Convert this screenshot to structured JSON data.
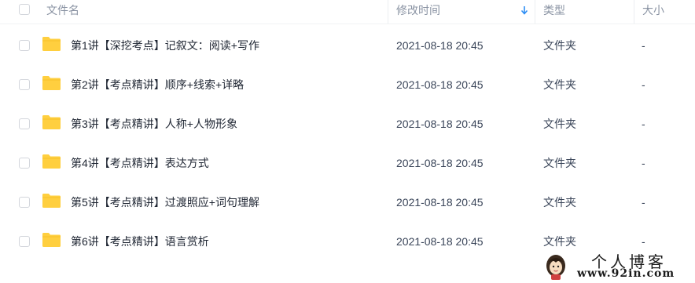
{
  "header": {
    "name_label": "文件名",
    "mtime_label": "修改时间",
    "type_label": "类型",
    "size_label": "大小",
    "sort_column": "mtime",
    "sort_direction": "descending",
    "accent_color": "#2c8df4"
  },
  "files": [
    {
      "name": "第1讲【深挖考点】记叙文：阅读+写作",
      "mtime": "2021-08-18 20:45",
      "type": "文件夹",
      "size": "-",
      "icon": "folder-icon"
    },
    {
      "name": "第2讲【考点精讲】顺序+线索+详略",
      "mtime": "2021-08-18 20:45",
      "type": "文件夹",
      "size": "-",
      "icon": "folder-icon"
    },
    {
      "name": "第3讲【考点精讲】人称+人物形象",
      "mtime": "2021-08-18 20:45",
      "type": "文件夹",
      "size": "-",
      "icon": "folder-icon"
    },
    {
      "name": "第4讲【考点精讲】表达方式",
      "mtime": "2021-08-18 20:45",
      "type": "文件夹",
      "size": "-",
      "icon": "folder-icon"
    },
    {
      "name": "第5讲【考点精讲】过渡照应+词句理解",
      "mtime": "2021-08-18 20:45",
      "type": "文件夹",
      "size": "-",
      "icon": "folder-icon"
    },
    {
      "name": "第6讲【考点精讲】语言赏析",
      "mtime": "2021-08-18 20:45",
      "type": "文件夹",
      "size": "-",
      "icon": "folder-icon"
    }
  ],
  "folder_color": "#ffcf3f",
  "watermark": {
    "title": "个人博客",
    "url": "www.92in.com"
  }
}
